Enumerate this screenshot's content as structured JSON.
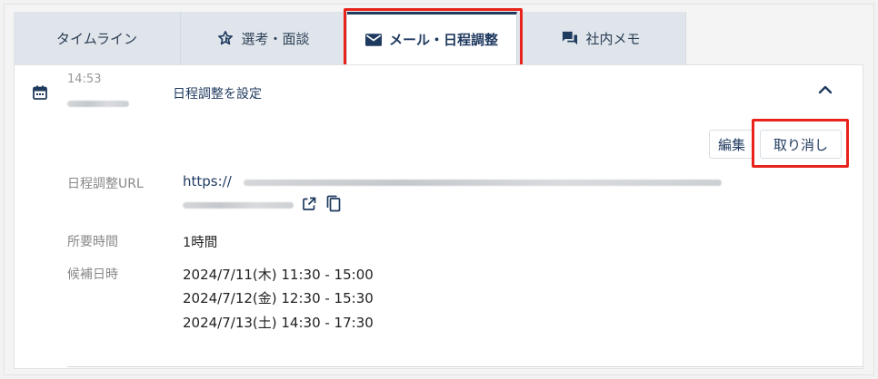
{
  "tabs": [
    {
      "label": "タイムライン",
      "icon": "none"
    },
    {
      "label": "選考・面談",
      "icon": "star-icon"
    },
    {
      "label": "メール・日程調整",
      "icon": "mail-icon"
    },
    {
      "label": "社内メモ",
      "icon": "chat-icon"
    }
  ],
  "active_tab": "メール・日程調整",
  "event": {
    "time": "14:53",
    "title": "日程調整を設定"
  },
  "actions": {
    "edit_label": "編集",
    "cancel_label": "取り消し"
  },
  "details": {
    "url_label": "日程調整URL",
    "url_prefix": "https://",
    "duration_label": "所要時間",
    "duration_value": "1時間",
    "candidates_label": "候補日時",
    "candidates": [
      "2024/7/11(木) 11:30 - 15:00",
      "2024/7/12(金) 12:30 - 15:30",
      "2024/7/13(土) 14:30 - 17:30"
    ]
  },
  "colors": {
    "accent": "#1f3a5f",
    "highlight": "#e8231c",
    "tab_bg": "#dfe5eb"
  }
}
